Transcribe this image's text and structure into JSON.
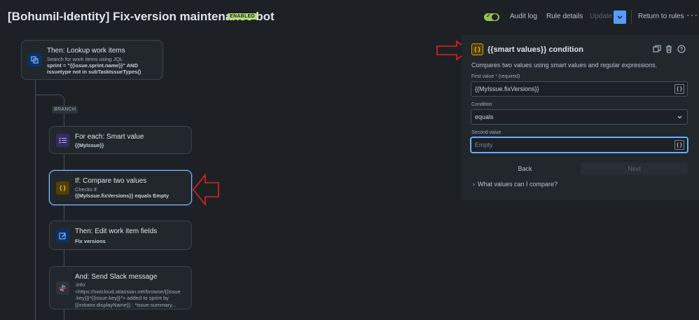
{
  "header": {
    "title": "[Bohumil-Identity] Fix-version maintenance bot",
    "badge": "ENABLED",
    "audit_log": "Audit log",
    "rule_details": "Rule details",
    "update": "Update",
    "return_to_rules": "Return to rules",
    "more": "···"
  },
  "canvas": {
    "branch_label": "BRANCH",
    "cards": [
      {
        "title": "Then: Lookup work items",
        "line1": "Search for work items using JQL",
        "line2": "sprint = \"{{issue.sprint.name}}\" AND",
        "line3": "issuetype not in subTaskIssueTypes()",
        "icon": "lookup-icon"
      },
      {
        "title": "For each: Smart value",
        "line1": "{{MyIssue}}",
        "icon": "list-icon"
      },
      {
        "title": "If: Compare two values",
        "line1": "Checks if:",
        "line2": "{{MyIssue.fixVersions}} equals Empty",
        "icon": "smart-value-icon"
      },
      {
        "title": "Then: Edit work item fields",
        "line1": "Fix versions",
        "icon": "edit-icon"
      },
      {
        "title": "And: Send Slack message",
        "line1": ":info:",
        "line2": "<https://swicloud.atlassian.net/browse/{{issue",
        "line3": ".key}}|*{{issue.key}}*> added to sprint by",
        "line4": "{{initiator.displayName}} : *issue.summary...",
        "icon": "slack-icon"
      }
    ]
  },
  "panel": {
    "title": "{{smart values}} condition",
    "icon_text": "{ }",
    "description": "Compares two values using smart values and regular expressions.",
    "first_value_label": "First value",
    "required_mark": "*",
    "required_text": "(required)",
    "first_value": "{{MyIssue.fixVersions}}",
    "condition_label": "Condition",
    "condition_value": "equals",
    "second_value_label": "Second value",
    "second_value_placeholder": "Empty",
    "smart_value_btn": "{ }",
    "back": "Back",
    "next": "Next",
    "expander": "What values can I compare?"
  },
  "colors": {
    "background": "#1d2125",
    "accent": "#579dff",
    "enabled": "#b3df72",
    "annotation_arrow": "#e2231a"
  }
}
